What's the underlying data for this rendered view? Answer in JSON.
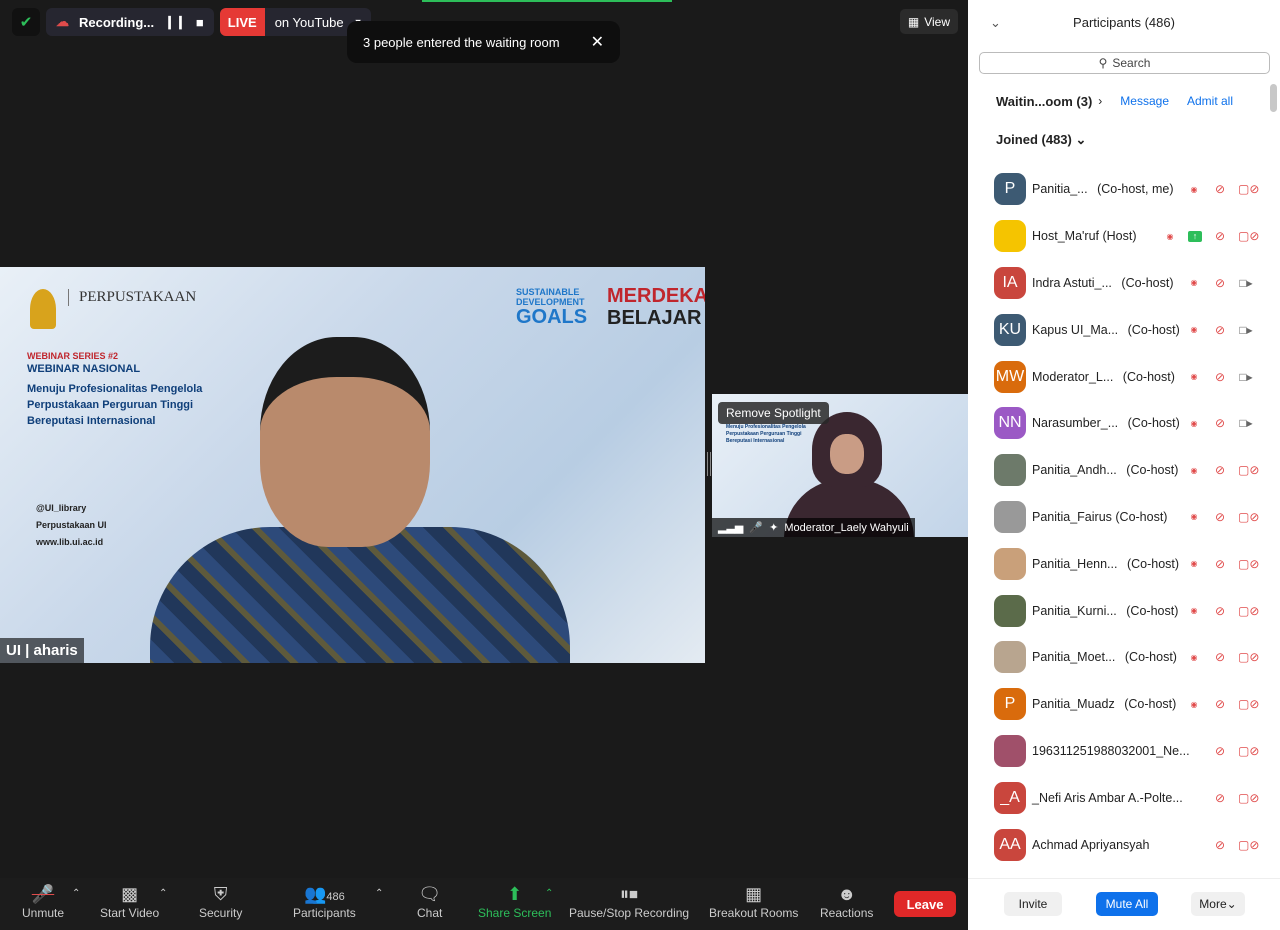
{
  "top": {
    "recording": "Recording...",
    "live": "LIVE",
    "live_target": "on YouTube",
    "view": "View"
  },
  "toast": {
    "text": "3 people entered the waiting room"
  },
  "video_main": {
    "name": "UI | aharis",
    "org": "PERPUSTAKAAN",
    "series": "WEBINAR SERIES #2",
    "webinar": "WEBINAR NASIONAL",
    "title": "Menuju Profesionalitas Pengelola Perpustakaan Perguruan Tinggi Bereputasi Internasional",
    "social": [
      "@UI_library",
      "Perpustakaan UI",
      "www.lib.ui.ac.id"
    ],
    "sdg": [
      "SUSTAINABLE",
      "DEVELOPMENT",
      "GOALS"
    ],
    "merdeka": [
      "MERDEKA",
      "BELAJAR"
    ]
  },
  "video_small": {
    "spotlight": "Remove Spotlight",
    "name": "Moderator_Laely Wahyuli"
  },
  "toolbar": {
    "unmute": "Unmute",
    "video": "Start Video",
    "security": "Security",
    "participants": "Participants",
    "count": "486",
    "chat": "Chat",
    "share": "Share Screen",
    "recording": "Pause/Stop Recording",
    "breakout": "Breakout Rooms",
    "reactions": "Reactions",
    "leave": "Leave"
  },
  "panel": {
    "title": "Participants (486)",
    "search": "Search",
    "waiting": "Waitin...oom (3)",
    "message": "Message",
    "admit": "Admit all",
    "joined": "Joined (483)",
    "invite": "Invite",
    "mute_all": "Mute All",
    "more": "More",
    "participants": [
      {
        "initials": "P",
        "color": "#3d5a73",
        "name": "Panitia_...",
        "role": "(Co-host, me)",
        "rec": true,
        "video": false
      },
      {
        "initials": "",
        "color": "#f5c400",
        "name": "Host_Ma'ruf (Host)",
        "role": "",
        "rec": true,
        "share": true,
        "video": false
      },
      {
        "initials": "IA",
        "color": "#c9463d",
        "name": "Indra Astuti_...",
        "role": "(Co-host)",
        "rec": true,
        "video": true
      },
      {
        "initials": "KU",
        "color": "#3d5a73",
        "name": "Kapus UI_Ma...",
        "role": "(Co-host)",
        "rec": true,
        "video": true
      },
      {
        "initials": "MW",
        "color": "#d96b0c",
        "name": "Moderator_L...",
        "role": "(Co-host)",
        "rec": true,
        "video": true
      },
      {
        "initials": "NN",
        "color": "#9b59c5",
        "name": "Narasumber_...",
        "role": "(Co-host)",
        "rec": true,
        "video": true
      },
      {
        "initials": "",
        "color": "#6d7a6a",
        "name": "Panitia_Andh...",
        "role": "(Co-host)",
        "rec": true,
        "video": false
      },
      {
        "initials": "",
        "color": "#999999",
        "name": "Panitia_Fairus (Co-host)",
        "role": "",
        "rec": true,
        "video": false
      },
      {
        "initials": "",
        "color": "#c9a07a",
        "name": "Panitia_Henn...",
        "role": "(Co-host)",
        "rec": true,
        "video": false
      },
      {
        "initials": "",
        "color": "#5b6b4a",
        "name": "Panitia_Kurni...",
        "role": "(Co-host)",
        "rec": true,
        "video": false
      },
      {
        "initials": "",
        "color": "#b8a58f",
        "name": "Panitia_Moet...",
        "role": "(Co-host)",
        "rec": true,
        "video": false
      },
      {
        "initials": "P",
        "color": "#d96b0c",
        "name": "Panitia_Muadz",
        "role": "(Co-host)",
        "rec": true,
        "video": false
      },
      {
        "initials": "",
        "color": "#a0506a",
        "name": "196311251988032001_Ne...",
        "role": "",
        "rec": false,
        "video": false
      },
      {
        "initials": "_A",
        "color": "#c9463d",
        "name": "_Nefi Aris Ambar A.-Polte...",
        "role": "",
        "rec": false,
        "video": false
      },
      {
        "initials": "AA",
        "color": "#c9463d",
        "name": "Achmad Apriyansyah",
        "role": "",
        "rec": false,
        "video": false
      }
    ]
  }
}
